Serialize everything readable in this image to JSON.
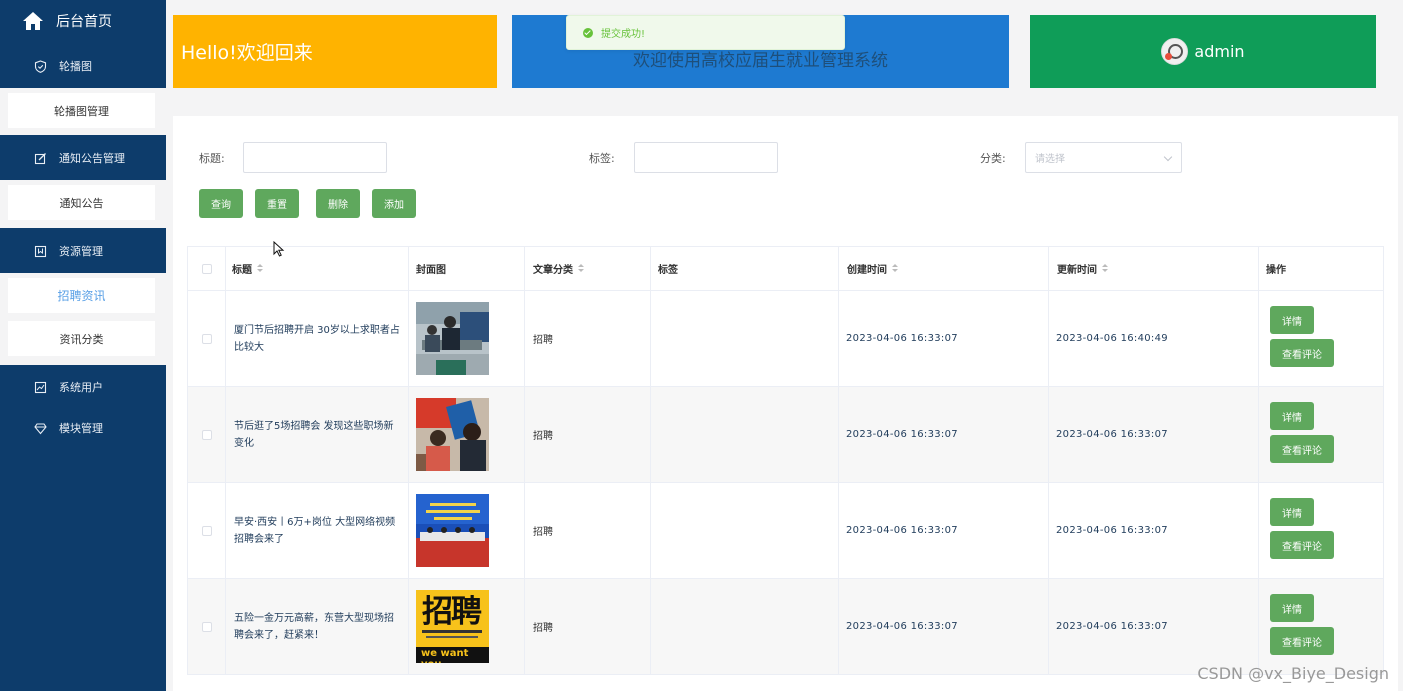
{
  "sidebar": {
    "home_label": "后台首页",
    "groups": [
      {
        "label": "轮播图",
        "icon": "shield-icon"
      },
      {
        "label": "通知公告管理",
        "icon": "edit-icon"
      },
      {
        "label": "资源管理",
        "icon": "bookmark-icon"
      },
      {
        "label": "系统用户",
        "icon": "chart-icon"
      },
      {
        "label": "模块管理",
        "icon": "diamond-icon"
      }
    ],
    "subs": [
      {
        "label": "轮播图管理"
      },
      {
        "label": "通知公告"
      },
      {
        "label": "招聘资讯",
        "active": true
      },
      {
        "label": "资讯分类"
      }
    ]
  },
  "cards": {
    "welcome": "Hello!欢迎回来",
    "system_title": "欢迎使用高校应届生就业管理系统",
    "user": "admin"
  },
  "toast": {
    "message": "提交成功!"
  },
  "filters": {
    "title_label": "标题:",
    "tag_label": "标签:",
    "category_label": "分类:",
    "category_placeholder": "请选择"
  },
  "buttons": {
    "query": "查询",
    "reset": "重置",
    "delete": "删除",
    "add": "添加"
  },
  "table": {
    "headers": {
      "title": "标题",
      "cover": "封面图",
      "category": "文章分类",
      "tag": "标签",
      "created": "创建时间",
      "updated": "更新时间",
      "actions": "操作"
    },
    "rows": [
      {
        "title": "厦门节后招聘开启 30岁以上求职者占比较大",
        "category": "招聘",
        "tag": "",
        "created": "2023-04-06 16:33:07",
        "updated": "2023-04-06 16:40:49"
      },
      {
        "title": "节后逛了5场招聘会 发现这些职场新变化",
        "category": "招聘",
        "tag": "",
        "created": "2023-04-06 16:33:07",
        "updated": "2023-04-06 16:33:07"
      },
      {
        "title": "早安·西安丨6万+岗位 大型网络视频招聘会来了",
        "category": "招聘",
        "tag": "",
        "created": "2023-04-06 16:33:07",
        "updated": "2023-04-06 16:33:07"
      },
      {
        "title": "五险一金万元高薪，东营大型现场招聘会来了，赶紧来！",
        "category": "招聘",
        "tag": "",
        "created": "2023-04-06 16:33:07",
        "updated": "2023-04-06 16:33:07"
      }
    ],
    "detail_label": "详情",
    "comments_label": "查看评论"
  },
  "thumb4_text": {
    "big": "招聘",
    "bottom": "we want you"
  },
  "watermark": "CSDN @vx_Biye_Design"
}
